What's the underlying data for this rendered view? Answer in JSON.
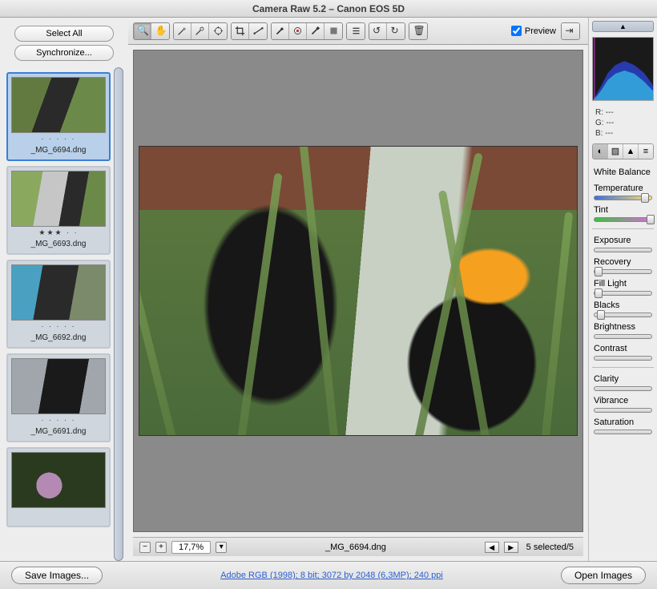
{
  "window": {
    "title": "Camera Raw 5.2  –  Canon EOS 5D"
  },
  "left": {
    "select_all": "Select All",
    "synchronize": "Synchronize...",
    "thumbs": [
      {
        "rating": "·  ·  ·  ·  ·",
        "name": "_MG_6694.dng",
        "imgclass": "cat1",
        "selected": true
      },
      {
        "rating": "★★★ ·  ·",
        "name": "_MG_6693.dng",
        "imgclass": "cat2",
        "selected": false
      },
      {
        "rating": "·  ·  ·  ·  ·",
        "name": "_MG_6692.dng",
        "imgclass": "cat3",
        "selected": false
      },
      {
        "rating": "·  ·  ·  ·  ·",
        "name": "_MG_6691.dng",
        "imgclass": "cat4",
        "selected": false
      },
      {
        "rating": "",
        "name": "",
        "imgclass": "cat5",
        "selected": false
      }
    ]
  },
  "toolbar": {
    "preview_label": "Preview",
    "preview_checked": true,
    "tools": [
      "zoom",
      "hand",
      "white-balance",
      "color-sampler",
      "target-adjust",
      "crop",
      "straighten",
      "spot",
      "red-eye",
      "brush",
      "eraser",
      "list",
      "rotate-ccw",
      "rotate-cw",
      "trash"
    ]
  },
  "status": {
    "zoom": "17,7%",
    "filename": "_MG_6694.dng",
    "selection": "5 selected/5"
  },
  "right": {
    "rgb": {
      "r": "R:   ---",
      "g": "G:   ---",
      "b": "B:   ---"
    },
    "wb_label": "White Balance",
    "temperature": "Temperature",
    "tint": "Tint",
    "exposure": "Exposure",
    "recovery": "Recovery",
    "fill_light": "Fill Light",
    "blacks": "Blacks",
    "brightness": "Brightness",
    "contrast": "Contrast",
    "clarity": "Clarity",
    "vibrance": "Vibrance",
    "saturation": "Saturation"
  },
  "bottom": {
    "save": "Save Images...",
    "open": "Open Images",
    "link": "Adobe RGB (1998); 8 bit; 3072 by 2048 (6,3MP); 240 ppi"
  }
}
